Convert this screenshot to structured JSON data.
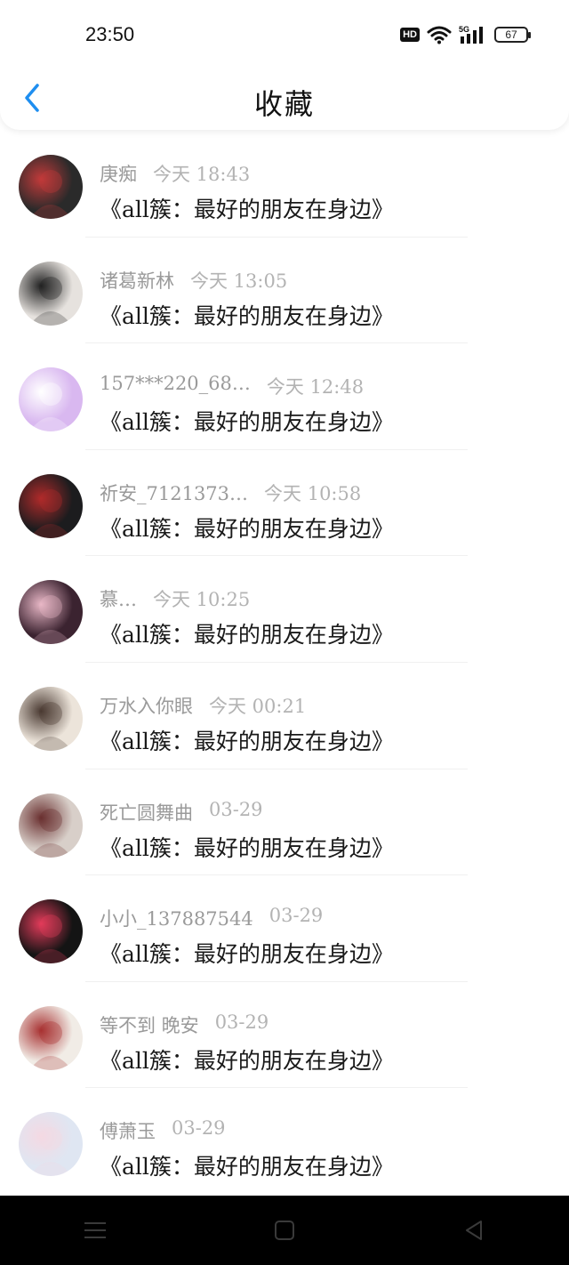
{
  "status_bar": {
    "time": "23:50",
    "hd": "HD",
    "network": "5G",
    "battery": "67"
  },
  "header": {
    "title": "收藏"
  },
  "favorites": [
    {
      "name": "庚痴",
      "time": "今天 18:43",
      "content": "《all簇：最好的朋友在身边》",
      "avatar_color": "#2a2a2a",
      "avatar_accent": "#c23a3a"
    },
    {
      "name": "诸葛新林",
      "time": "今天 13:05",
      "content": "《all簇：最好的朋友在身边》",
      "avatar_color": "#e6e2de",
      "avatar_accent": "#222222"
    },
    {
      "name": "157***220_68…",
      "time": "今天 12:48",
      "content": "《all簇：最好的朋友在身边》",
      "avatar_color": "#d9b8f0",
      "avatar_accent": "#ffffff"
    },
    {
      "name": "祈安_7121373…",
      "time": "今天 10:58",
      "content": "《all簇：最好的朋友在身边》",
      "avatar_color": "#1c1c1e",
      "avatar_accent": "#b02a2a"
    },
    {
      "name": "慕…",
      "time": "今天 10:25",
      "content": "《all簇：最好的朋友在身边》",
      "avatar_color": "#3b2330",
      "avatar_accent": "#e8b7c6"
    },
    {
      "name": "万水入你眼",
      "time": "今天 00:21",
      "content": "《all簇：最好的朋友在身边》",
      "avatar_color": "#ece4da",
      "avatar_accent": "#4a3a32"
    },
    {
      "name": "死亡圆舞曲",
      "time": "03-29",
      "content": "《all簇：最好的朋友在身边》",
      "avatar_color": "#d8cfc9",
      "avatar_accent": "#6a3030"
    },
    {
      "name": "小小_137887544",
      "time": "03-29",
      "content": "《all簇：最好的朋友在身边》",
      "avatar_color": "#141414",
      "avatar_accent": "#e23b5a"
    },
    {
      "name": "等不到 晚安",
      "time": "03-29",
      "content": "《all簇：最好的朋友在身边》",
      "avatar_color": "#f1ece6",
      "avatar_accent": "#a83232"
    },
    {
      "name": "傅萧玉",
      "time": "03-29",
      "content": "《all簇：最好的朋友在身边》",
      "avatar_color": "#dfe6f2",
      "avatar_accent": "#f4d9e3"
    }
  ],
  "colors": {
    "accent": "#1e8ef0",
    "name_text": "#9a9a9a",
    "time_text": "#b3b3b3",
    "content_text": "#1a1a1a"
  },
  "nav_icons": [
    "menu-icon",
    "home-square-icon",
    "back-triangle-icon"
  ]
}
